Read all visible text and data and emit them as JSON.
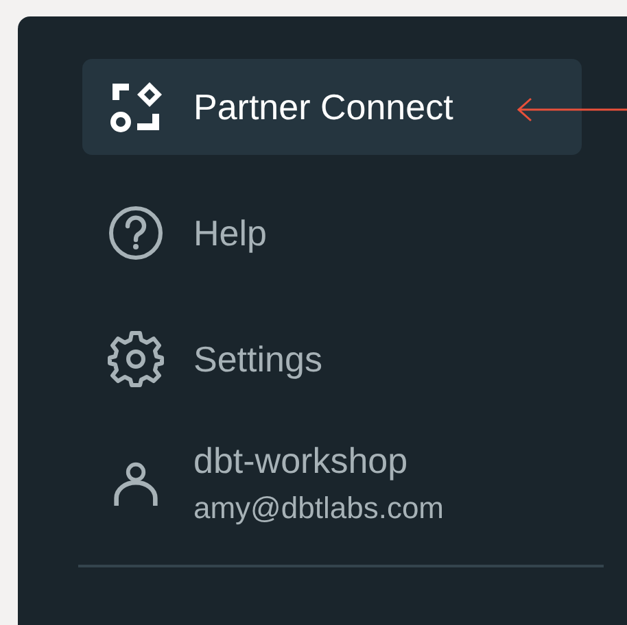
{
  "nav_items": [
    {
      "label": "Partner Connect",
      "selected": true
    },
    {
      "label": "Help",
      "selected": false
    },
    {
      "label": "Settings",
      "selected": false
    }
  ],
  "account": {
    "name": "dbt-workshop",
    "email": "amy@dbtlabs.com"
  }
}
